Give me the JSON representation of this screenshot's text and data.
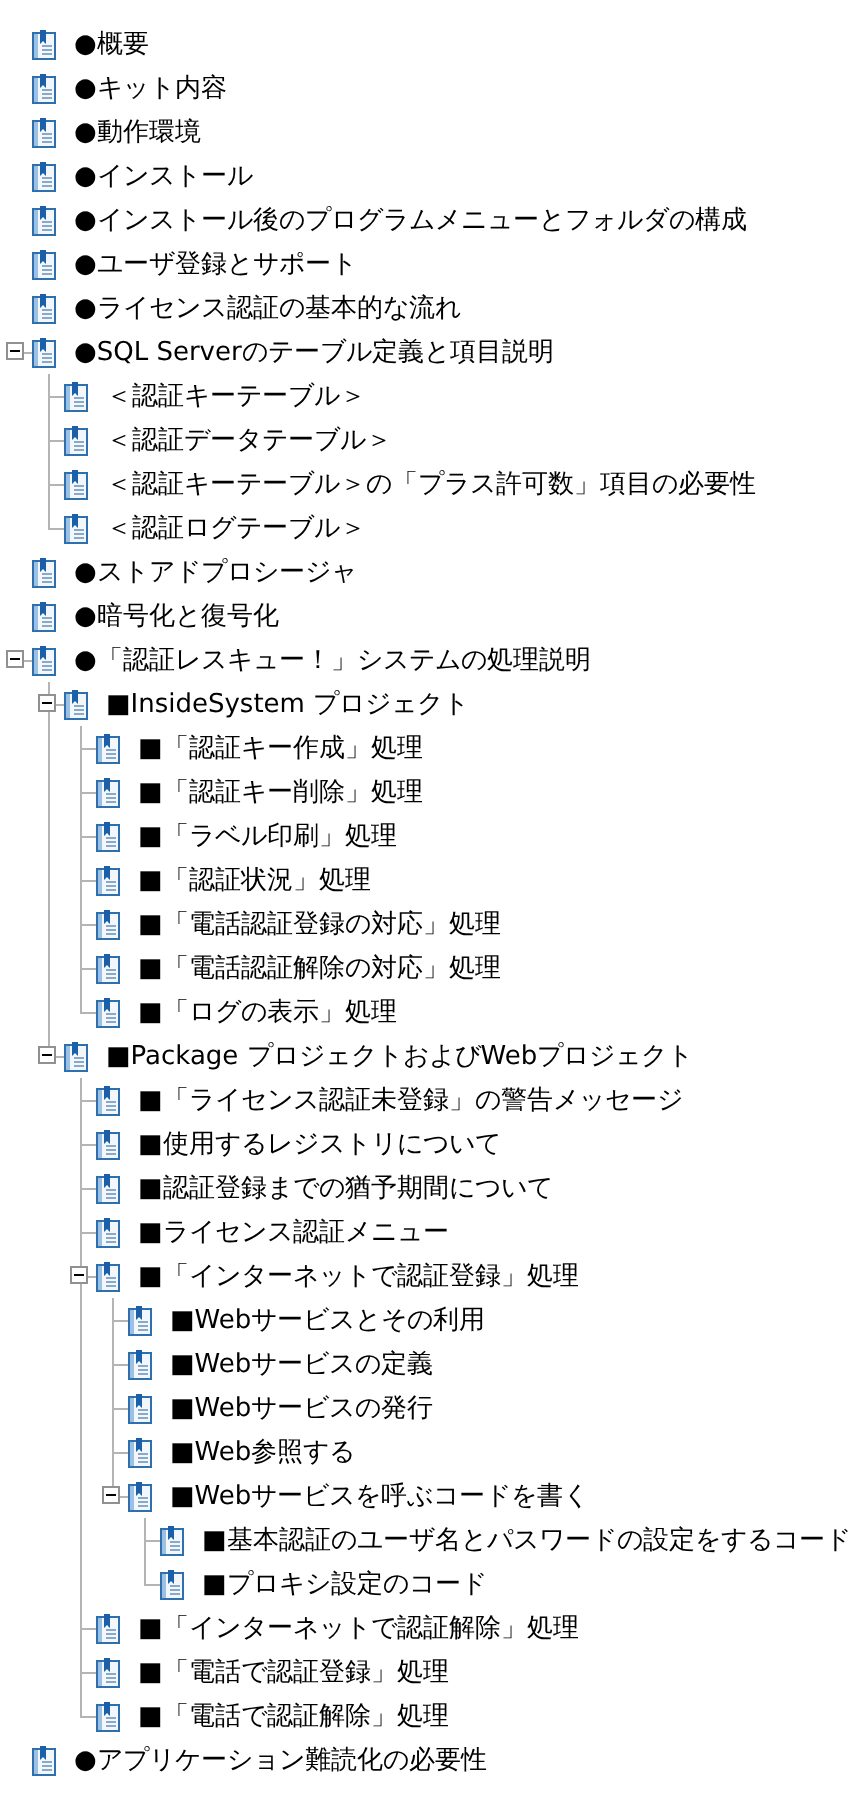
{
  "tree": [
    {
      "label": "●概要"
    },
    {
      "label": "●キット内容"
    },
    {
      "label": "●動作環境"
    },
    {
      "label": "●インストール"
    },
    {
      "label": "●インストール後のプログラムメニューとフォルダの構成"
    },
    {
      "label": "●ユーザ登録とサポート"
    },
    {
      "label": "●ライセンス認証の基本的な流れ"
    },
    {
      "label": "●SQL Serverのテーブル定義と項目説明",
      "expanded": true,
      "children": [
        {
          "label": "＜認証キーテーブル＞"
        },
        {
          "label": "＜認証データテーブル＞"
        },
        {
          "label": "＜認証キーテーブル＞の「プラス許可数」項目の必要性"
        },
        {
          "label": "＜認証ログテーブル＞"
        }
      ]
    },
    {
      "label": "●ストアドプロシージャ"
    },
    {
      "label": "●暗号化と復号化"
    },
    {
      "label": "●「認証レスキュー！」システムの処理説明",
      "expanded": true,
      "children": [
        {
          "label": "■InsideSystem プロジェクト",
          "expanded": true,
          "children": [
            {
              "label": "■「認証キー作成」処理"
            },
            {
              "label": "■「認証キー削除」処理"
            },
            {
              "label": "■「ラベル印刷」処理"
            },
            {
              "label": "■「認証状況」処理"
            },
            {
              "label": "■「電話認証登録の対応」処理"
            },
            {
              "label": "■「電話認証解除の対応」処理"
            },
            {
              "label": "■「ログの表示」処理"
            }
          ]
        },
        {
          "label": "■Package プロジェクトおよびWebプロジェクト",
          "expanded": true,
          "children": [
            {
              "label": "■「ライセンス認証未登録」の警告メッセージ"
            },
            {
              "label": "■使用するレジストリについて"
            },
            {
              "label": "■認証登録までの猶予期間について"
            },
            {
              "label": "■ライセンス認証メニュー"
            },
            {
              "label": "■「インターネットで認証登録」処理",
              "expanded": true,
              "children": [
                {
                  "label": "■Webサービスとその利用"
                },
                {
                  "label": "■Webサービスの定義"
                },
                {
                  "label": "■Webサービスの発行"
                },
                {
                  "label": "■Web参照する"
                },
                {
                  "label": "■Webサービスを呼ぶコードを書く",
                  "expanded": true,
                  "children": [
                    {
                      "label": "■基本認証のユーザ名とパスワードの設定をするコード"
                    },
                    {
                      "label": "■プロキシ設定のコード"
                    }
                  ]
                }
              ]
            },
            {
              "label": "■「インターネットで認証解除」処理"
            },
            {
              "label": "■「電話で認証登録」処理"
            },
            {
              "label": "■「電話で認証解除」処理"
            }
          ]
        }
      ]
    },
    {
      "label": "●アプリケーション難読化の必要性"
    }
  ]
}
